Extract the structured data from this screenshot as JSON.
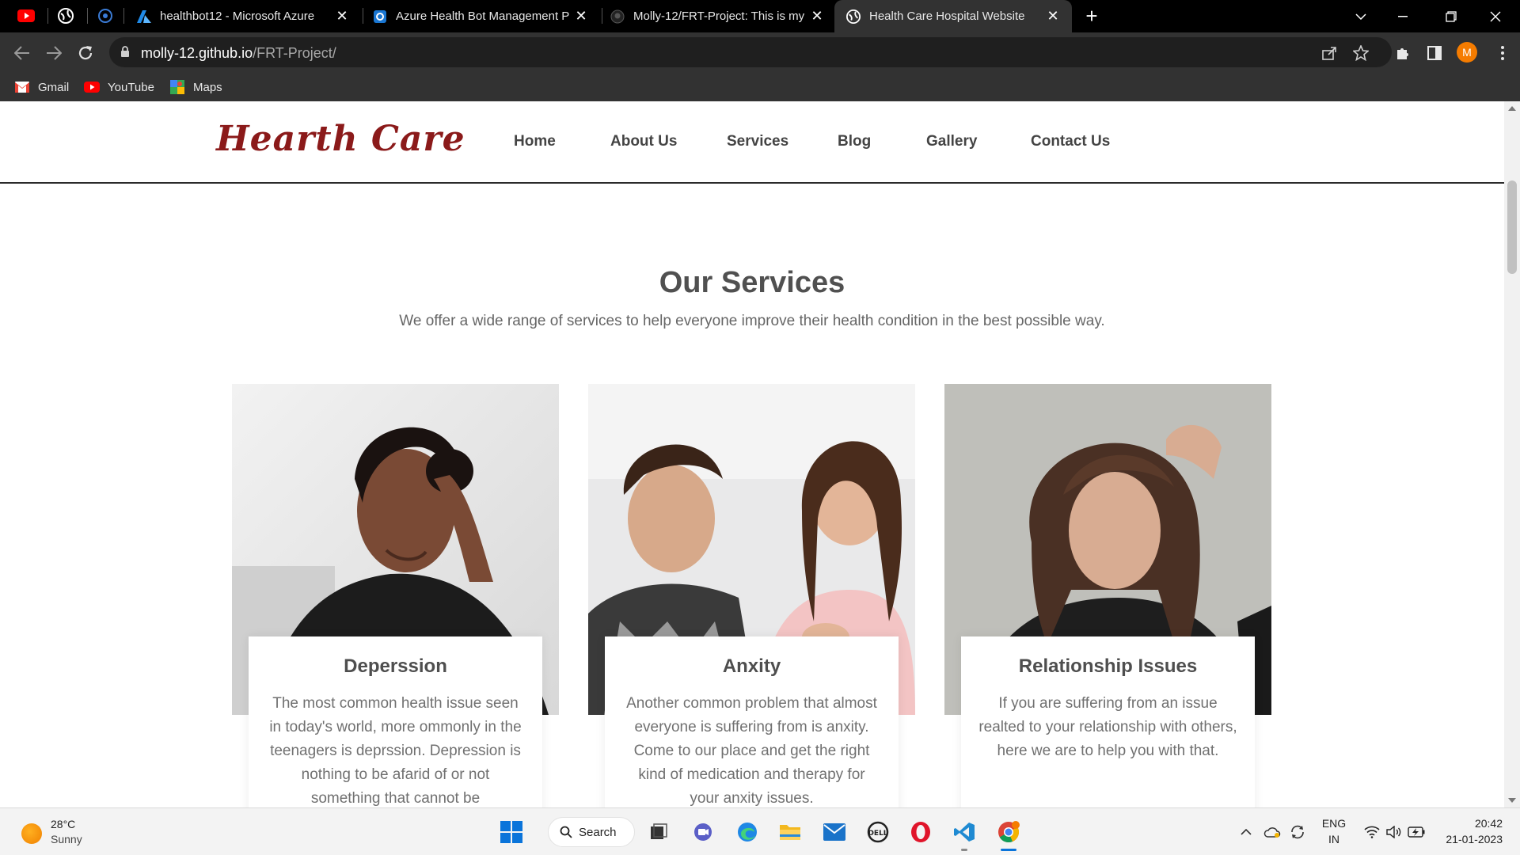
{
  "browser": {
    "tabs": [
      {
        "title": "healthbot12 - Microsoft Azure"
      },
      {
        "title": "Azure Health Bot Management P"
      },
      {
        "title": "Molly-12/FRT-Project: This is my"
      },
      {
        "title": "Health Care Hospital Website"
      }
    ],
    "url_host": "molly-12.github.io",
    "url_path": "/FRT-Project/",
    "profile_initial": "M",
    "bookmarks": [
      {
        "label": "Gmail"
      },
      {
        "label": "YouTube"
      },
      {
        "label": "Maps"
      }
    ]
  },
  "site": {
    "logo": "Hearth Care",
    "nav": [
      "Home",
      "About Us",
      "Services",
      "Blog",
      "Gallery",
      "Contact Us"
    ],
    "services": {
      "title": "Our Services",
      "subtitle": "We offer a wide range of services to help everyone improve their health condition in the best possible way.",
      "cards": [
        {
          "title": "Deperssion",
          "text": "The most common health issue seen in today's world, more ommonly in the teenagers is deprssion. Depression is nothing to be afarid of or not something that cannot be"
        },
        {
          "title": "Anxity",
          "text": "Another common problem that almost everyone is suffering from is anxity. Come to our place and get the right kind of medication and therapy for your anxity issues."
        },
        {
          "title": "Relationship Issues",
          "text": "If you are suffering from an issue realted to your relationship with others, here we are to help you with that."
        }
      ]
    }
  },
  "taskbar": {
    "weather_temp": "28°C",
    "weather_desc": "Sunny",
    "search_label": "Search",
    "lang_top": "ENG",
    "lang_bottom": "IN",
    "time": "20:42",
    "date": "21-01-2023"
  },
  "colors": {
    "logo": "#8b1a1a",
    "avatar": "#f57c00",
    "tabstrip": "#000000",
    "toolbar": "#323232"
  }
}
